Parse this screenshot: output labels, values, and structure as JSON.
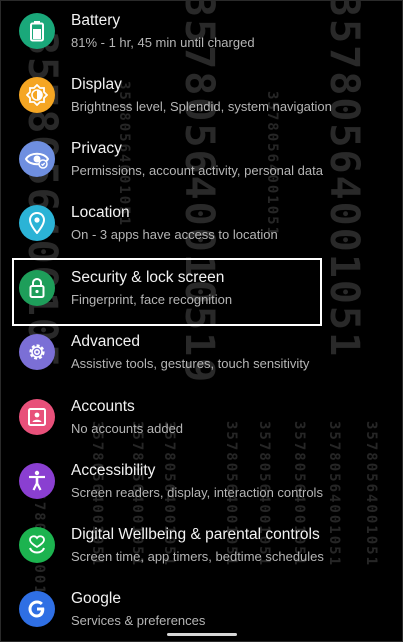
{
  "settings_items": [
    {
      "title": "Battery",
      "subtitle": "81% - 1 hr, 45 min until charged",
      "icon": "battery-icon",
      "color": "#1AA87A"
    },
    {
      "title": "Display",
      "subtitle": "Brightness level, Splendid, system navigation",
      "icon": "brightness-icon",
      "color": "#F5A623"
    },
    {
      "title": "Privacy",
      "subtitle": "Permissions, account activity, personal data",
      "icon": "privacy-eye-icon",
      "color": "#6F8FE0"
    },
    {
      "title": "Location",
      "subtitle": "On - 3 apps have access to location",
      "icon": "location-pin-icon",
      "color": "#2BB3D6"
    },
    {
      "title": "Security & lock screen",
      "subtitle": "Fingerprint, face recognition",
      "icon": "lock-icon",
      "color": "#1E9E5A"
    },
    {
      "title": "Advanced",
      "subtitle": "Assistive tools, gestures, touch sensitivity",
      "icon": "gear-icon",
      "color": "#7B6FD6"
    },
    {
      "title": "Accounts",
      "subtitle": "No accounts added",
      "icon": "account-card-icon",
      "color": "#E8507A"
    },
    {
      "title": "Accessibility",
      "subtitle": "Screen readers, display, interaction controls",
      "icon": "accessibility-icon",
      "color": "#8A3FD1"
    },
    {
      "title": "Digital Wellbeing & parental controls",
      "subtitle": "Screen time, app timers, bedtime schedules",
      "icon": "wellbeing-heart-icon",
      "color": "#1CB34F"
    },
    {
      "title": "Google",
      "subtitle": "Services & preferences",
      "icon": "google-icon",
      "color": "#2F6FE4"
    }
  ],
  "watermark_text": "35780564001051",
  "watermark_text_short": "357805640010519",
  "watermark_text_alt": "3578056400105"
}
